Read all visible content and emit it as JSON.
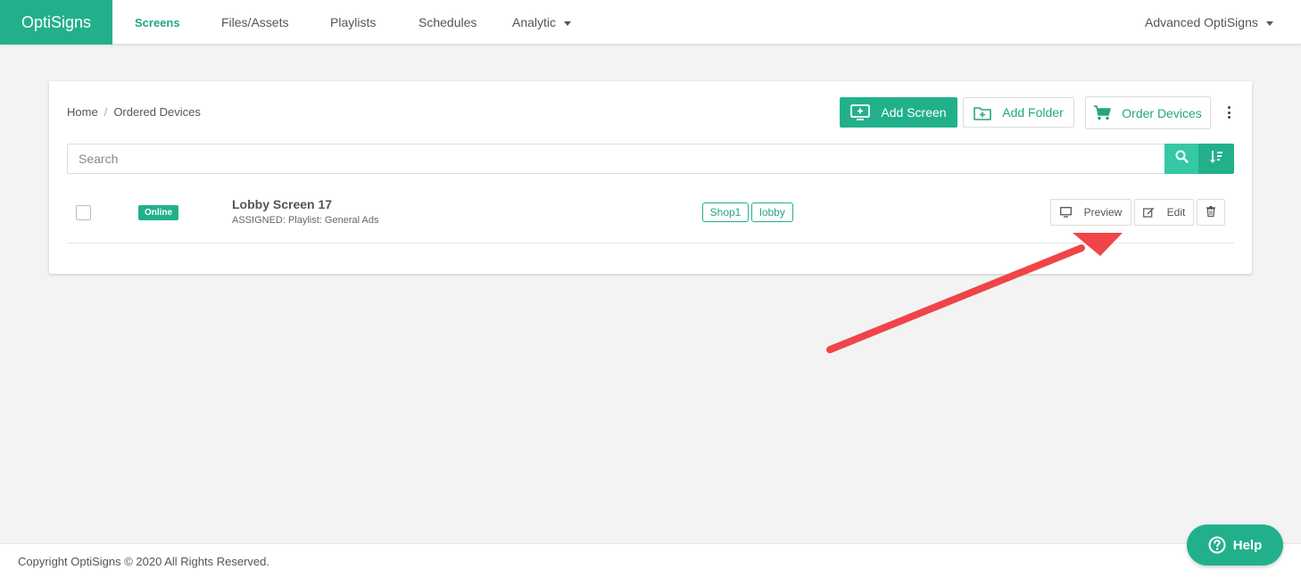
{
  "brand": {
    "name": "OptiSigns",
    "color": "#22b08c"
  },
  "nav": {
    "screens": "Screens",
    "files": "Files/Assets",
    "playlists": "Playlists",
    "schedules": "Schedules",
    "analytic": "Analytic",
    "account": "Advanced OptiSigns"
  },
  "breadcrumb": {
    "home": "Home",
    "separator": "/",
    "current": "Ordered Devices"
  },
  "toolbar": {
    "add_screen": "Add Screen",
    "add_folder": "Add Folder",
    "order_devices": "Order Devices"
  },
  "search": {
    "placeholder": "Search",
    "value": ""
  },
  "devices": [
    {
      "status": "Online",
      "name": "Lobby Screen 17",
      "assigned": "ASSIGNED: Playlist: General Ads",
      "tags": [
        "Shop1",
        "lobby"
      ],
      "actions": {
        "preview": "Preview",
        "edit": "Edit"
      }
    }
  ],
  "footer": {
    "copyright": "Copyright OptiSigns © 2020 All Rights Reserved."
  },
  "help": {
    "label": "Help"
  },
  "icons": {
    "add_screen": "monitor-plus-icon",
    "add_folder": "folder-plus-icon",
    "order": "cart-icon",
    "search": "search-icon",
    "sort": "sort-icon",
    "preview": "monitor-icon",
    "edit": "edit-icon",
    "delete": "trash-icon",
    "help": "question-circle-icon"
  },
  "annotation_color": "#f04448"
}
